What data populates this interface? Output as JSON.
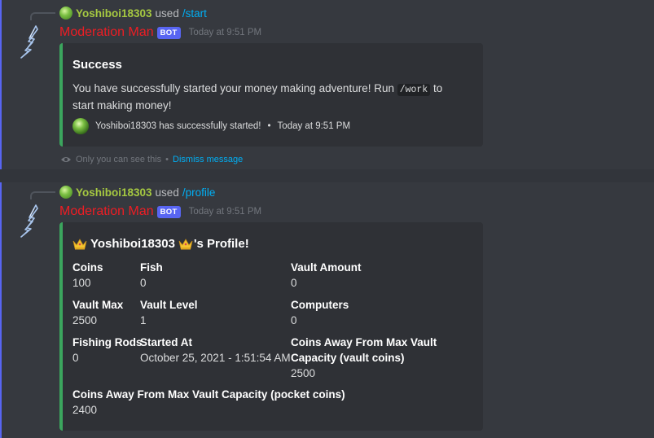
{
  "messages": [
    {
      "reply": {
        "user": "Yoshiboi18303",
        "used": "used",
        "command": "/start"
      },
      "author": "Moderation Man",
      "bot_tag": "BOT",
      "timestamp": "Today at 9:51 PM",
      "embed": {
        "title": "Success",
        "description_before": "You have successfully started your money making adventure! Run ",
        "description_code": "/work",
        "description_after": " to start making money!",
        "footer_text": "Yoshiboi18303 has successfully started!",
        "footer_sep": "•",
        "footer_time": "Today at 9:51 PM"
      },
      "ephemeral": {
        "notice": "Only you can see this",
        "sep": "•",
        "dismiss": "Dismiss message"
      }
    },
    {
      "reply": {
        "user": "Yoshiboi18303",
        "used": "used",
        "command": "/profile"
      },
      "author": "Moderation Man",
      "bot_tag": "BOT",
      "timestamp": "Today at 9:51 PM",
      "embed": {
        "title_name": "Yoshiboi18303",
        "title_suffix": "'s Profile!",
        "fields": [
          {
            "name": "Coins",
            "value": "100"
          },
          {
            "name": "Fish",
            "value": "0"
          },
          {
            "name": "Vault Amount",
            "value": "0"
          },
          {
            "name": "Vault Max",
            "value": "2500"
          },
          {
            "name": "Vault Level",
            "value": "1"
          },
          {
            "name": "Computers",
            "value": "0"
          },
          {
            "name": "Fishing Rods",
            "value": "0"
          },
          {
            "name": "Started At",
            "value": "October 25, 2021 - 1:51:54 AM"
          },
          {
            "name": "Coins Away From Max Vault Capacity (vault coins)",
            "value": "2500"
          },
          {
            "name": "Coins Away From Max Vault Capacity (pocket coins)",
            "value": "2400"
          }
        ]
      }
    }
  ],
  "colors": {
    "background": "#36393f",
    "embed_bg": "#2f3136",
    "embed_border": "#3ba55d",
    "username": "#ed1d24",
    "reply_user": "#a6c941",
    "link": "#00aff4",
    "bot_tag": "#5865f2"
  },
  "icons": {
    "avatar": "lightning-bolt-icon",
    "reply_avatar": "green-orb-icon",
    "ephemeral": "eye-icon",
    "crown": "crown-icon"
  }
}
